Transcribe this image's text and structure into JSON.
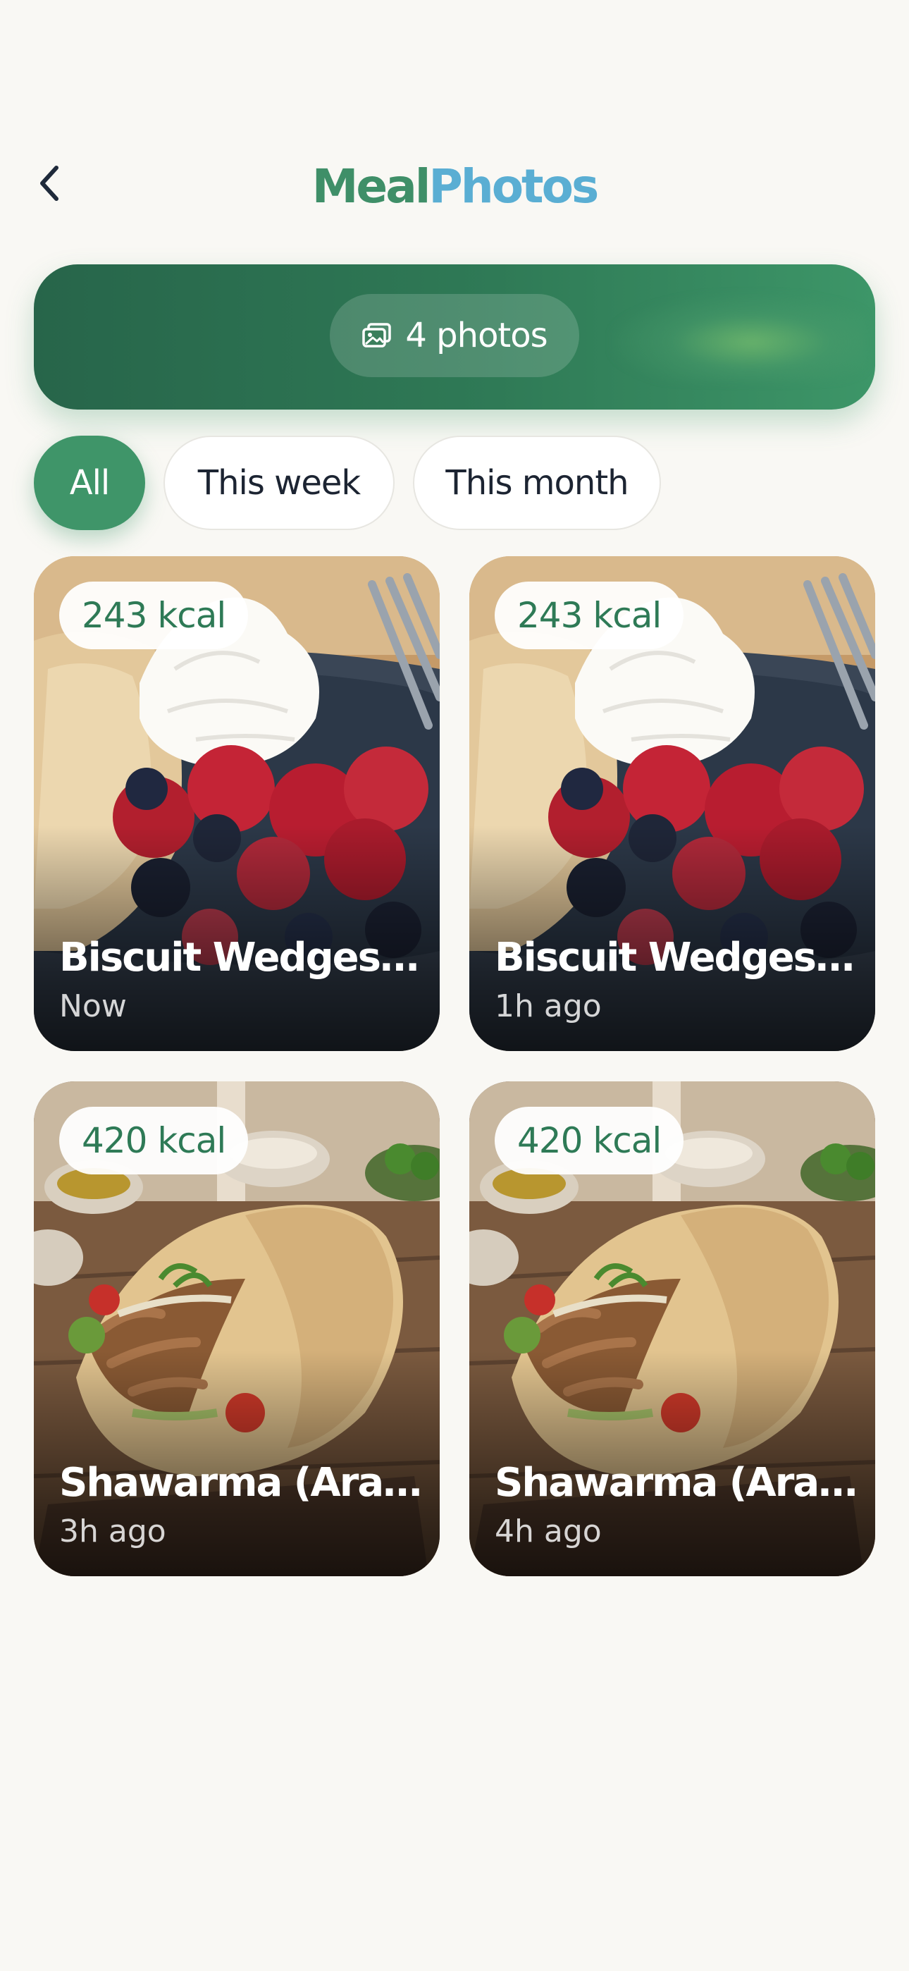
{
  "header": {
    "title_part1": "Meal",
    "title_part2": "Photos",
    "back_icon": "chevron-left-icon"
  },
  "summary": {
    "photos_label": "4 photos",
    "icon": "photos-icon"
  },
  "filters": [
    {
      "label": "All",
      "active": true
    },
    {
      "label": "This week",
      "active": false
    },
    {
      "label": "This month",
      "active": false
    }
  ],
  "meals": [
    {
      "kcal": "243 kcal",
      "name": "Biscuit Wedges w...",
      "time": "Now",
      "image": "biscuit-berries-cream"
    },
    {
      "kcal": "243 kcal",
      "name": "Biscuit Wedges w...",
      "time": "1h ago",
      "image": "biscuit-berries-cream"
    },
    {
      "kcal": "420 kcal",
      "name": "Shawarma (Arabic)",
      "time": "3h ago",
      "image": "shawarma-wrap"
    },
    {
      "kcal": "420 kcal",
      "name": "Shawarma (Arabic)",
      "time": "4h ago",
      "image": "shawarma-wrap"
    }
  ],
  "colors": {
    "brand_green": "#3f8f68",
    "brand_blue": "#5aaed3",
    "banner_dark": "#27654a",
    "background": "#f9f8f4"
  }
}
